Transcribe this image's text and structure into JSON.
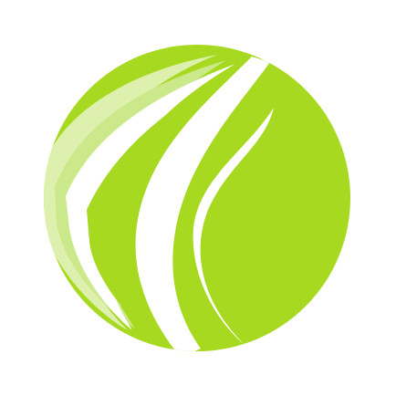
{
  "logo": {
    "icon": "green-leaf-swirl-logo",
    "colors": {
      "primary_green": "#A6D91F",
      "light_green": "#CBE98A",
      "pale_green": "#DDF0AE",
      "background": "#FFFFFF"
    }
  }
}
